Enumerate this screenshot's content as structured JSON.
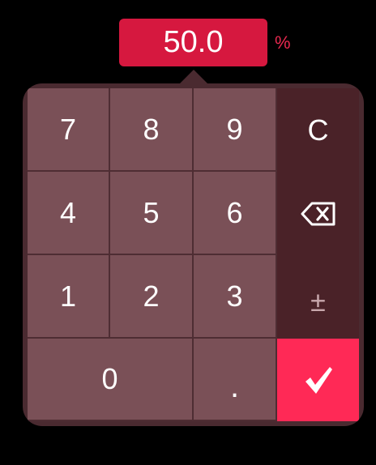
{
  "display": {
    "value": "50.0",
    "unit": "%"
  },
  "keypad": {
    "digits": {
      "d7": "7",
      "d8": "8",
      "d9": "9",
      "d4": "4",
      "d5": "5",
      "d6": "6",
      "d1": "1",
      "d2": "2",
      "d3": "3",
      "d0": "0",
      "dot": "."
    },
    "clear_label": "C",
    "sign_label": "±",
    "backspace_icon": "backspace-icon",
    "confirm_icon": "checkmark-icon"
  },
  "colors": {
    "display_bg": "#d6183f",
    "unit_text": "#e8294f",
    "digit_key": "#7a5057",
    "function_column": "#4a2228",
    "confirm_key": "#ff2956"
  }
}
